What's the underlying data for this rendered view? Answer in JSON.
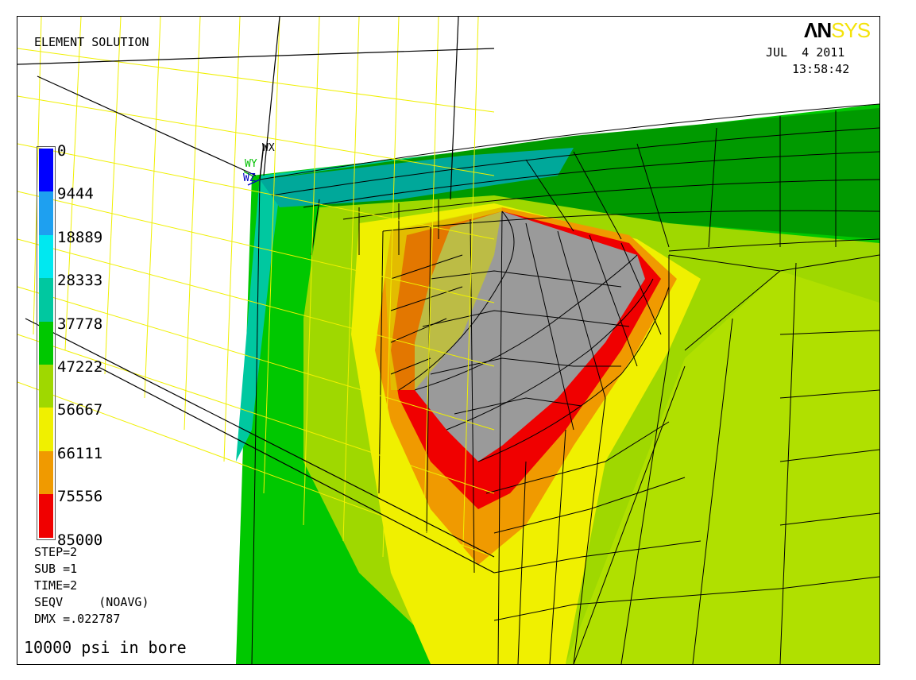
{
  "header": {
    "title": "ELEMENT SOLUTION",
    "date": "JUL  4 2011",
    "time": "13:58:42",
    "logo_main": "ΛN",
    "logo_accent": "SYS"
  },
  "triad": {
    "x_label": "WX",
    "y_label": "WY",
    "z_label": "WZ",
    "x_color": "#000000",
    "y_color": "#00c000",
    "z_color": "#0000c0"
  },
  "legend": {
    "items": [
      {
        "label": "0",
        "color": "#0000ff"
      },
      {
        "label": "9444",
        "color": "#1ea0f0"
      },
      {
        "label": "18889",
        "color": "#00e8f0"
      },
      {
        "label": "28333",
        "color": "#00c8a0"
      },
      {
        "label": "37778",
        "color": "#00c800"
      },
      {
        "label": "47222",
        "color": "#9fd800"
      },
      {
        "label": "56667",
        "color": "#f0f000"
      },
      {
        "label": "66111",
        "color": "#f09a00"
      },
      {
        "label": "75556",
        "color": "#f00000"
      },
      {
        "label": "85000",
        "color": ""
      }
    ]
  },
  "info": {
    "step": "STEP=2",
    "sub": "SUB =1",
    "time": "TIME=2",
    "seqv": "SEQV     (NOAVG)",
    "dmx": "DMX =.022787"
  },
  "caption": "10000 psi in bore"
}
